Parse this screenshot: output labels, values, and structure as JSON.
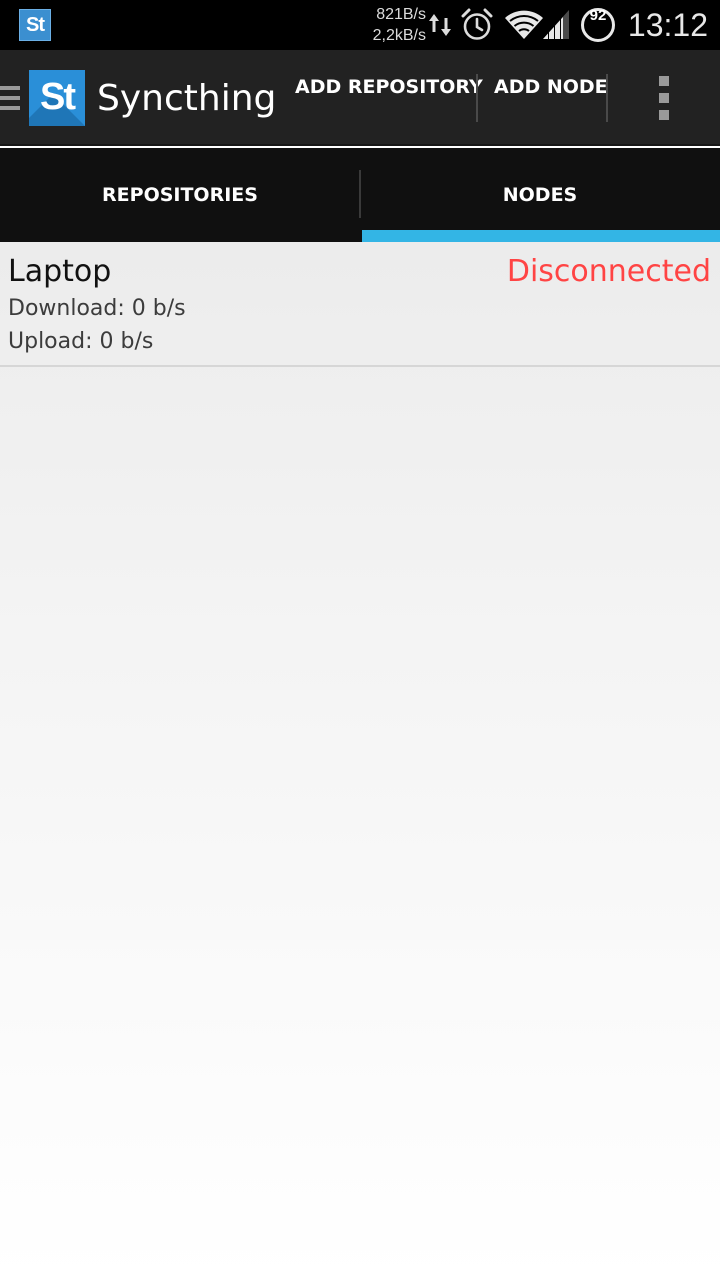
{
  "status_bar": {
    "notification_icon": "syncthing-app-icon",
    "notification_text": "St",
    "rate_up": "821B/s",
    "rate_down": "2,2kB/s",
    "battery": "92",
    "time": "13:12",
    "icons": [
      "data-transfer-arrows-icon",
      "alarm-clock-icon",
      "wifi-icon",
      "signal-icon",
      "battery-circle-icon"
    ]
  },
  "action_bar": {
    "logo_text": "St",
    "title": "Syncthing",
    "actions": [
      "ADD REPOSITORY",
      "ADD NODE"
    ],
    "overflow_icon": "overflow-menu-icon",
    "up_icon": "drawer-indicator-icon"
  },
  "tabs": {
    "items": [
      {
        "label": "REPOSITORIES",
        "selected": false
      },
      {
        "label": "NODES",
        "selected": true
      }
    ],
    "indicator_color": "#33b5e5"
  },
  "nodes": [
    {
      "name": "Laptop",
      "status": "Disconnected",
      "status_color": "#ff4444",
      "download": "Download: 0 b/s",
      "upload": "Upload: 0 b/s"
    }
  ]
}
